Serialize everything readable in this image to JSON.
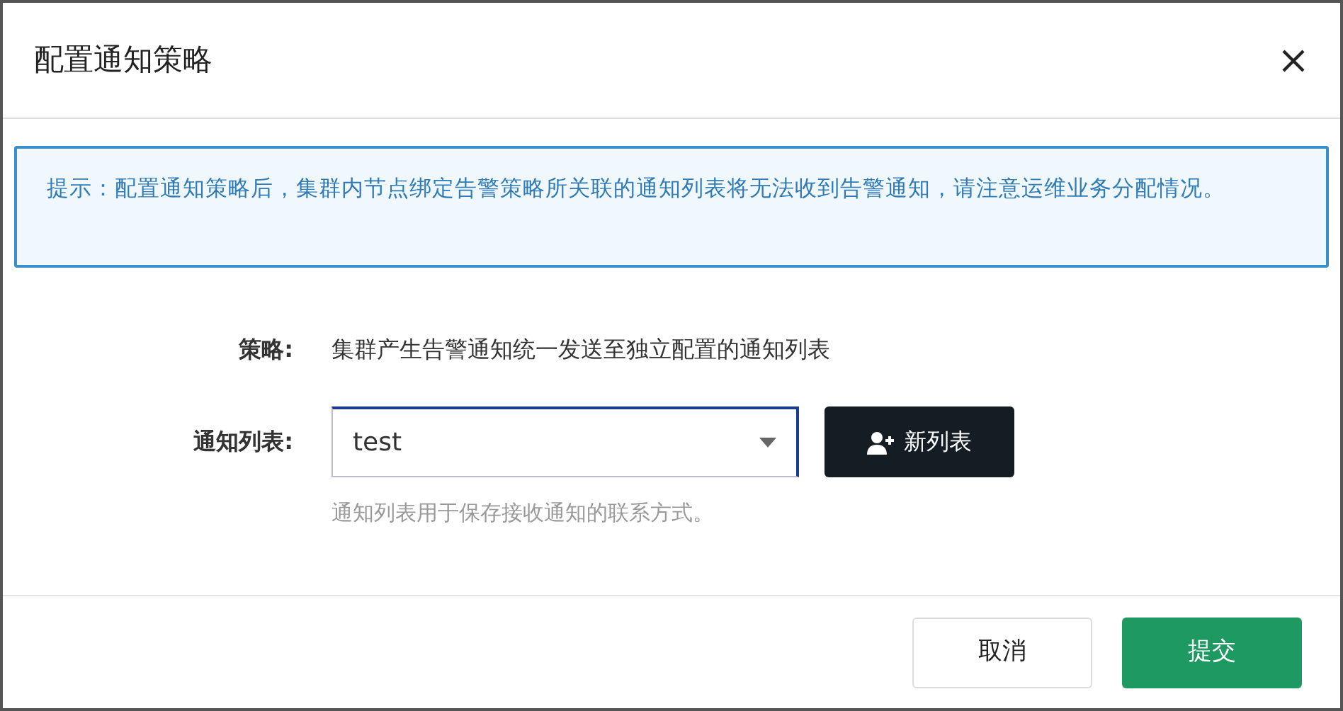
{
  "dialog": {
    "title": "配置通知策略"
  },
  "notice": "提示：配置通知策略后，集群内节点绑定告警策略所关联的通知列表将无法收到告警通知，请注意运维业务分配情况。",
  "policy": {
    "label": "策略:",
    "value": "集群产生告警通知统一发送至独立配置的通知列表"
  },
  "notify_list": {
    "label": "通知列表:",
    "value": "test",
    "focused": true,
    "new_button": "新列表",
    "help": "通知列表用于保存接收通知的联系方式。"
  },
  "buttons": [
    {
      "label": "取消",
      "kind": "secondary"
    },
    {
      "label": "提交",
      "kind": "primary"
    }
  ]
}
